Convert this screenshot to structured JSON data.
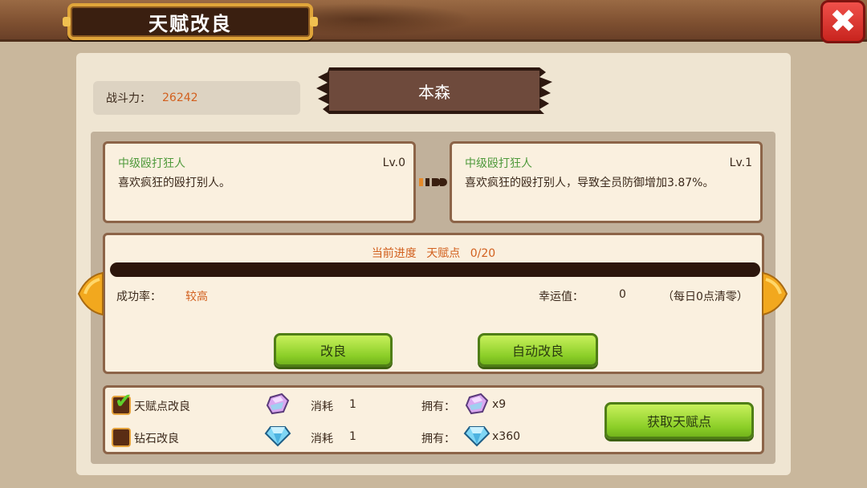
{
  "header": {
    "title": "天赋改良",
    "close_label": "✖"
  },
  "power": {
    "label": "战斗力：",
    "value": "26242"
  },
  "hero_name": "本森",
  "current_talent": {
    "name": "中级殴打狂人",
    "level": "Lv.0",
    "desc": "喜欢疯狂的殴打别人。"
  },
  "next_talent": {
    "name": "中级殴打狂人",
    "level": "Lv.1",
    "desc": "喜欢疯狂的殴打别人，导致全员防御增加3.87%。"
  },
  "progress": {
    "label": "当前进度",
    "point_label": "天赋点",
    "value": "0/20",
    "fraction": 0
  },
  "success_rate": {
    "label": "成功率：",
    "value": "较高"
  },
  "luck": {
    "label": "幸运值：",
    "value": "0",
    "note": "（每日0点清零）"
  },
  "buttons": {
    "improve": "改良",
    "auto_improve": "自动改良",
    "get_points": "获取天赋点"
  },
  "costs": [
    {
      "label": "天赋点改良",
      "checked": true,
      "cost_label": "消耗",
      "cost": "1",
      "own_label": "拥有：",
      "own": "x9",
      "icon": "talent-crystal-icon"
    },
    {
      "label": "钻石改良",
      "checked": false,
      "cost_label": "消耗",
      "cost": "1",
      "own_label": "拥有：",
      "own": "x360",
      "icon": "diamond-icon"
    }
  ],
  "colors": {
    "accent_orange": "#d2601e",
    "talent_green": "#4f9a3c",
    "button_green": "#8ccf28"
  }
}
